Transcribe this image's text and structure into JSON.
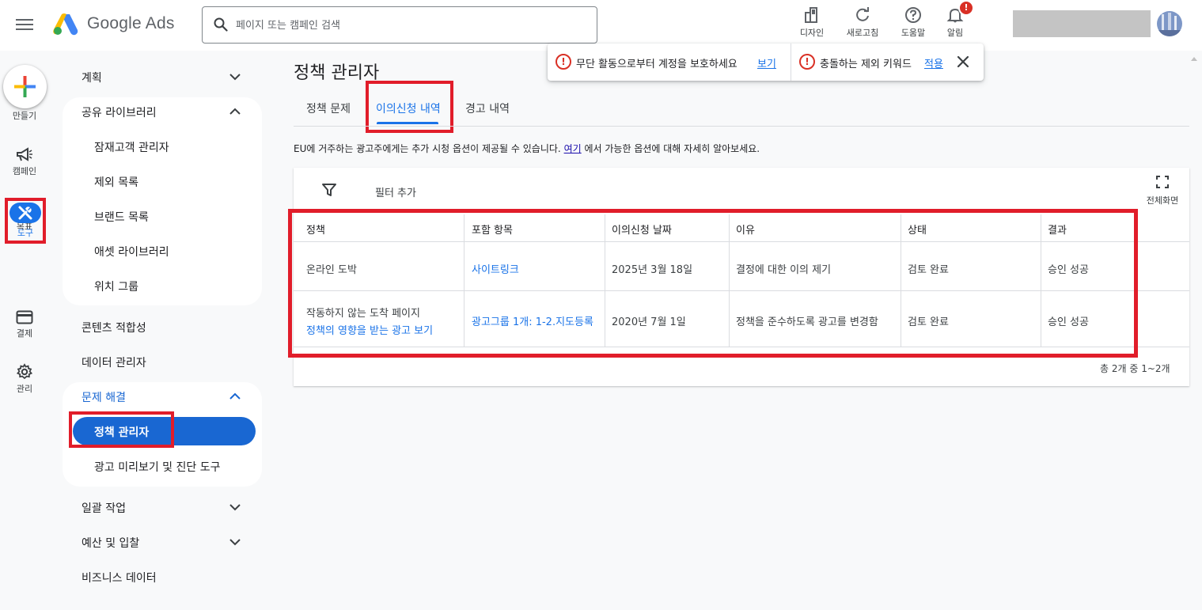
{
  "header": {
    "brand": "Google Ads",
    "search_placeholder": "페이지 또는 캠페인 검색",
    "tools": [
      {
        "label": "디자인",
        "icon": "appearance-icon"
      },
      {
        "label": "새로고침",
        "icon": "refresh-icon"
      },
      {
        "label": "도움말",
        "icon": "help-icon"
      },
      {
        "label": "알림",
        "icon": "bell-icon",
        "badge": "!"
      }
    ]
  },
  "rail": {
    "create_label": "만들기",
    "items": [
      {
        "label": "캠페인",
        "icon": "megaphone-icon"
      },
      {
        "label": "목표",
        "icon": "trophy-icon"
      },
      {
        "label": "도구",
        "icon": "tools-icon",
        "active": true
      },
      {
        "label": "결제",
        "icon": "credit-card-icon"
      },
      {
        "label": "관리",
        "icon": "gear-icon"
      }
    ]
  },
  "sidenav": {
    "plan": "계획",
    "shared_library": "공유 라이브러리",
    "shared_items": [
      "잠재고객 관리자",
      "제외 목록",
      "브랜드 목록",
      "애셋 라이브러리",
      "위치 그룹"
    ],
    "content_suitability": "콘텐츠 적합성",
    "data_manager": "데이터 관리자",
    "troubleshooting": "문제 해결",
    "troubleshooting_items": [
      "정책 관리자",
      "광고 미리보기 및 진단 도구"
    ],
    "bulk_actions": "일괄 작업",
    "budgets_bidding": "예산 및 입찰",
    "business_data": "비즈니스 데이터"
  },
  "main": {
    "title": "정책 관리자",
    "tabs": [
      "정책 문제",
      "이의신청 내역",
      "경고 내역"
    ],
    "active_tab": 1,
    "eu_note_before": "EU에 거주하는 광고주에게는 추가 시청 옵션이 제공될 수 있습니다.",
    "eu_note_link": "여기",
    "eu_note_after": "에서 가능한 옵션에 대해 자세히 알아보세요.",
    "filter_label": "필터 추가",
    "fullscreen_label": "전체화면",
    "columns": [
      "정책",
      "포함 항목",
      "이의신청 날짜",
      "이유",
      "상태",
      "결과"
    ],
    "rows": [
      {
        "policy": "온라인 도박",
        "policy_link": "",
        "item": "사이트링크",
        "date": "2025년 3월 18일",
        "reason": "결정에 대한 이의 제기",
        "status": "검토 완료",
        "result": "승인 성공"
      },
      {
        "policy": "작동하지 않는 도착 페이지",
        "policy_link": "정책의 영향을 받는 광고 보기",
        "item": "광고그룹 1개: 1-2.지도등록",
        "date": "2020년 7월 1일",
        "reason": "정책을 준수하도록 광고를 변경함",
        "status": "검토 완료",
        "result": "승인 성공"
      }
    ],
    "pagination": "총 2개 중 1~2개"
  },
  "notification": {
    "item1_text": "무단 활동으로부터 계정을 보호하세요",
    "item1_link": "보기",
    "item2_text": "충돌하는 제외 키워드",
    "item2_link": "적용"
  },
  "colors": {
    "accent": "#1a73e8",
    "highlight": "#e11d2a",
    "warning": "#d93025"
  }
}
